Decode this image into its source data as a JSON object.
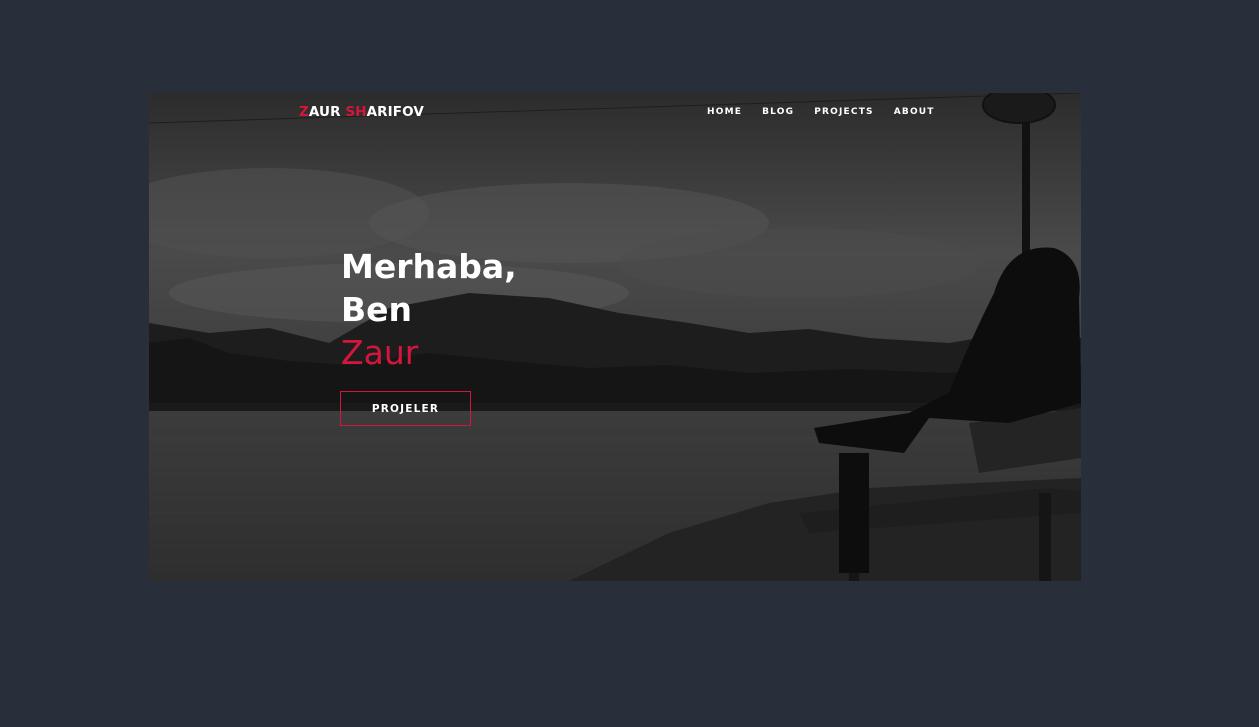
{
  "colors": {
    "page_background": "#282f3b",
    "accent": "#d4163c",
    "text": "#ffffff"
  },
  "logo": {
    "part1_accent": "Z",
    "part2": "AUR ",
    "part3_accent": "SH",
    "part4": "ARIFOV"
  },
  "nav": {
    "items": [
      {
        "label": "HOME"
      },
      {
        "label": "BLOG"
      },
      {
        "label": "PROJECTS"
      },
      {
        "label": "ABOUT"
      }
    ]
  },
  "hero": {
    "line1": "Merhaba,",
    "line2": "Ben",
    "line3": "Zaur",
    "cta_label": "PROJELER"
  }
}
